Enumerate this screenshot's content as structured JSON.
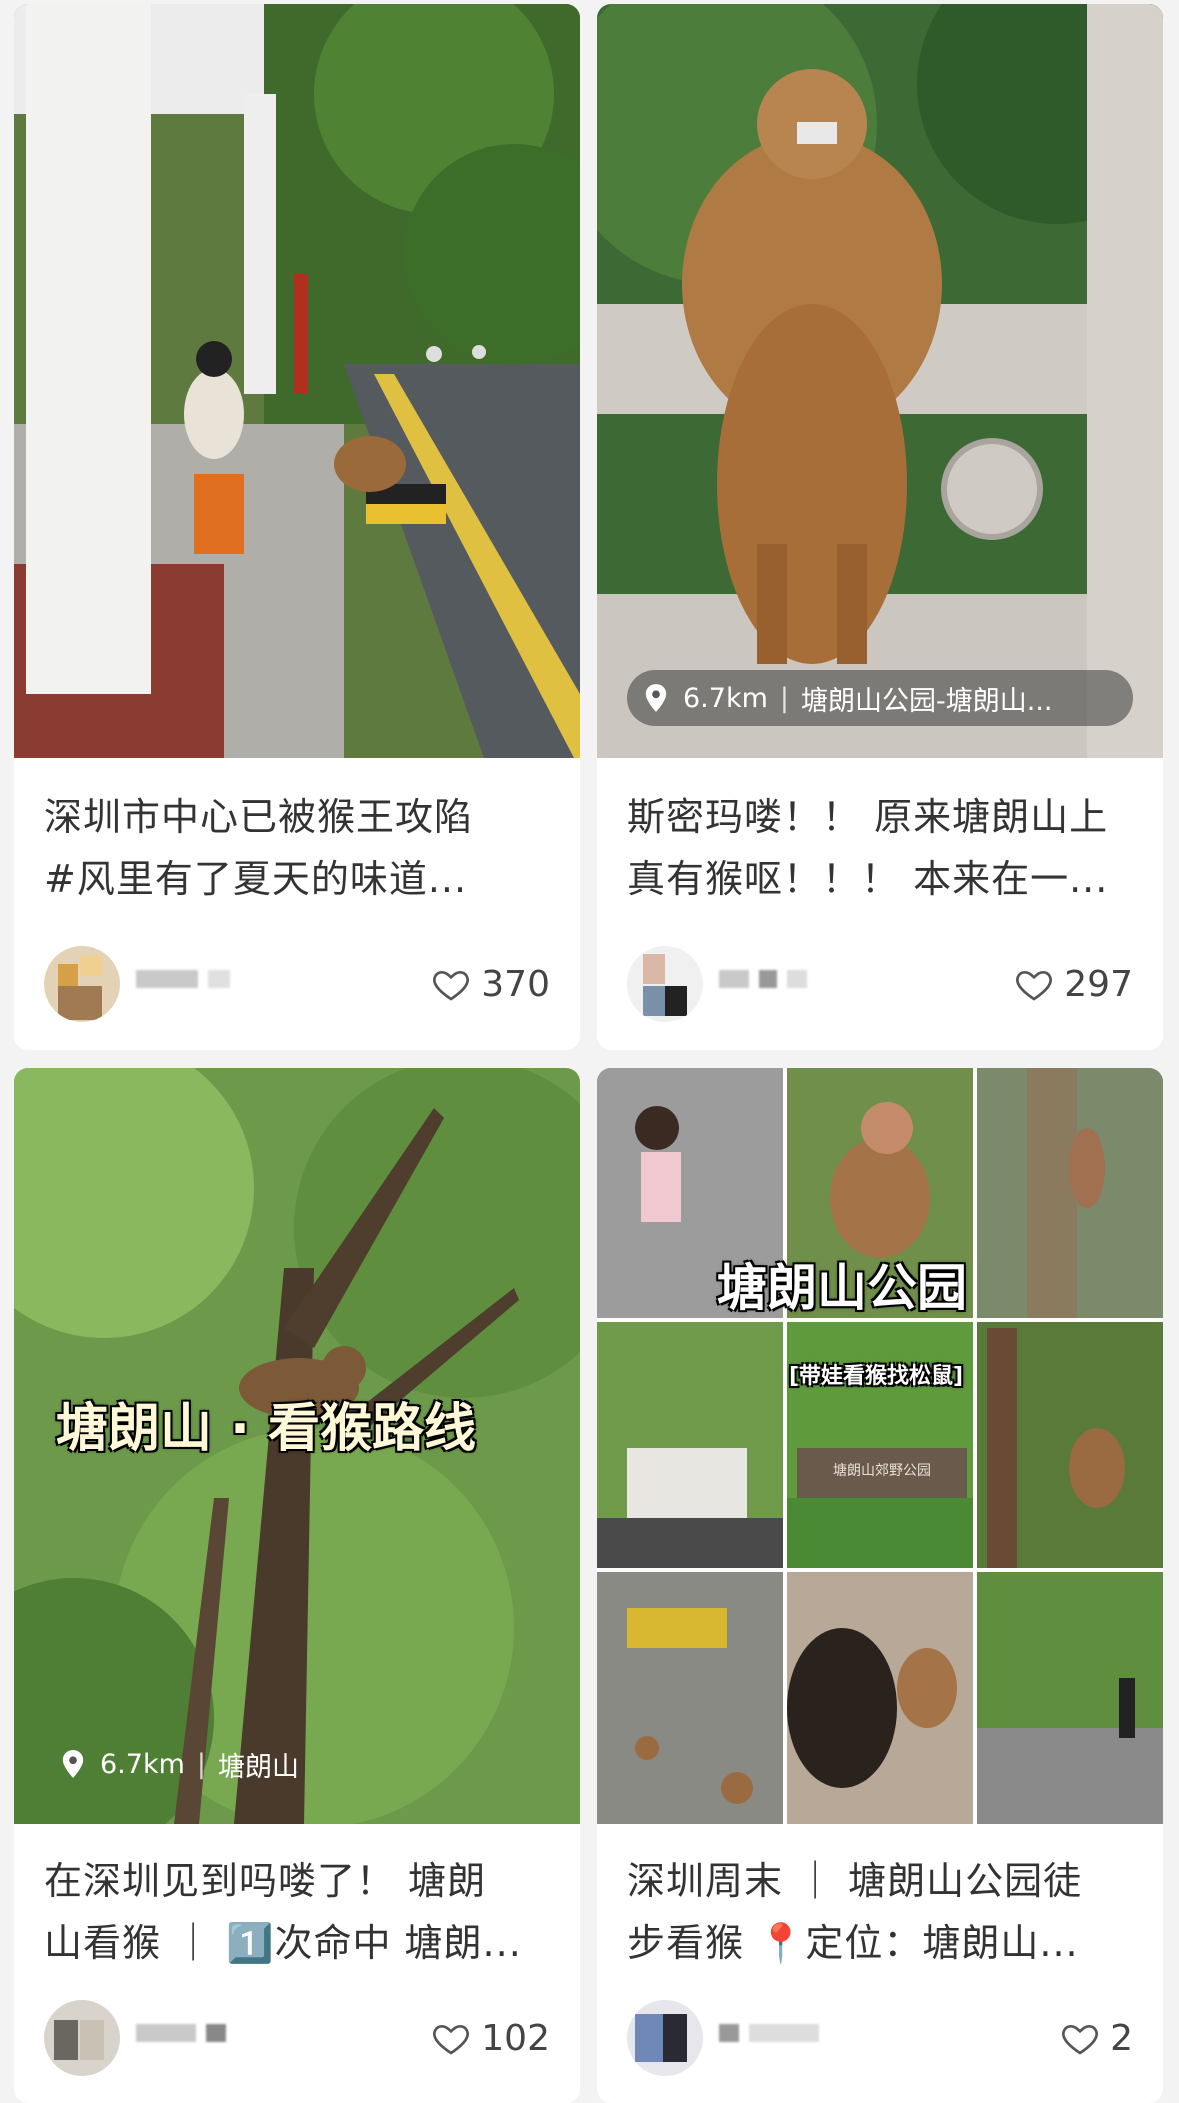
{
  "feed": [
    {
      "title": "深圳市中心已被猴王攻陷\n#风里有了夏天的味道...",
      "likes": "370"
    },
    {
      "title": "斯密玛喽！！ 原来塘朗山上\n真有猴呕！！！ 本来在一...",
      "likes": "297",
      "distance": "6.7km",
      "place": "塘朗山公园-塘朗山..."
    },
    {
      "title": "在深圳见到吗喽了！ 塘朗\n山看猴 ｜ 1️⃣次命中 塘朗...",
      "likes": "102",
      "distance": "6.7km",
      "place": "塘朗山",
      "overlay": "塘朗山 · 看猴路线"
    },
    {
      "title": "深圳周末 ｜ 塘朗山公园徒\n步看猴 📍定位：塘朗山...",
      "likes": "2",
      "overlay": "塘朗山公园",
      "sub_overlay": "[带娃看猴找松鼠]",
      "sign": "塘朗山郊野公园"
    }
  ],
  "colors": {
    "background": "#f3f3f3",
    "card": "#ffffff",
    "text": "#333333"
  },
  "icons": [
    "heart-icon",
    "location-pin-icon"
  ]
}
